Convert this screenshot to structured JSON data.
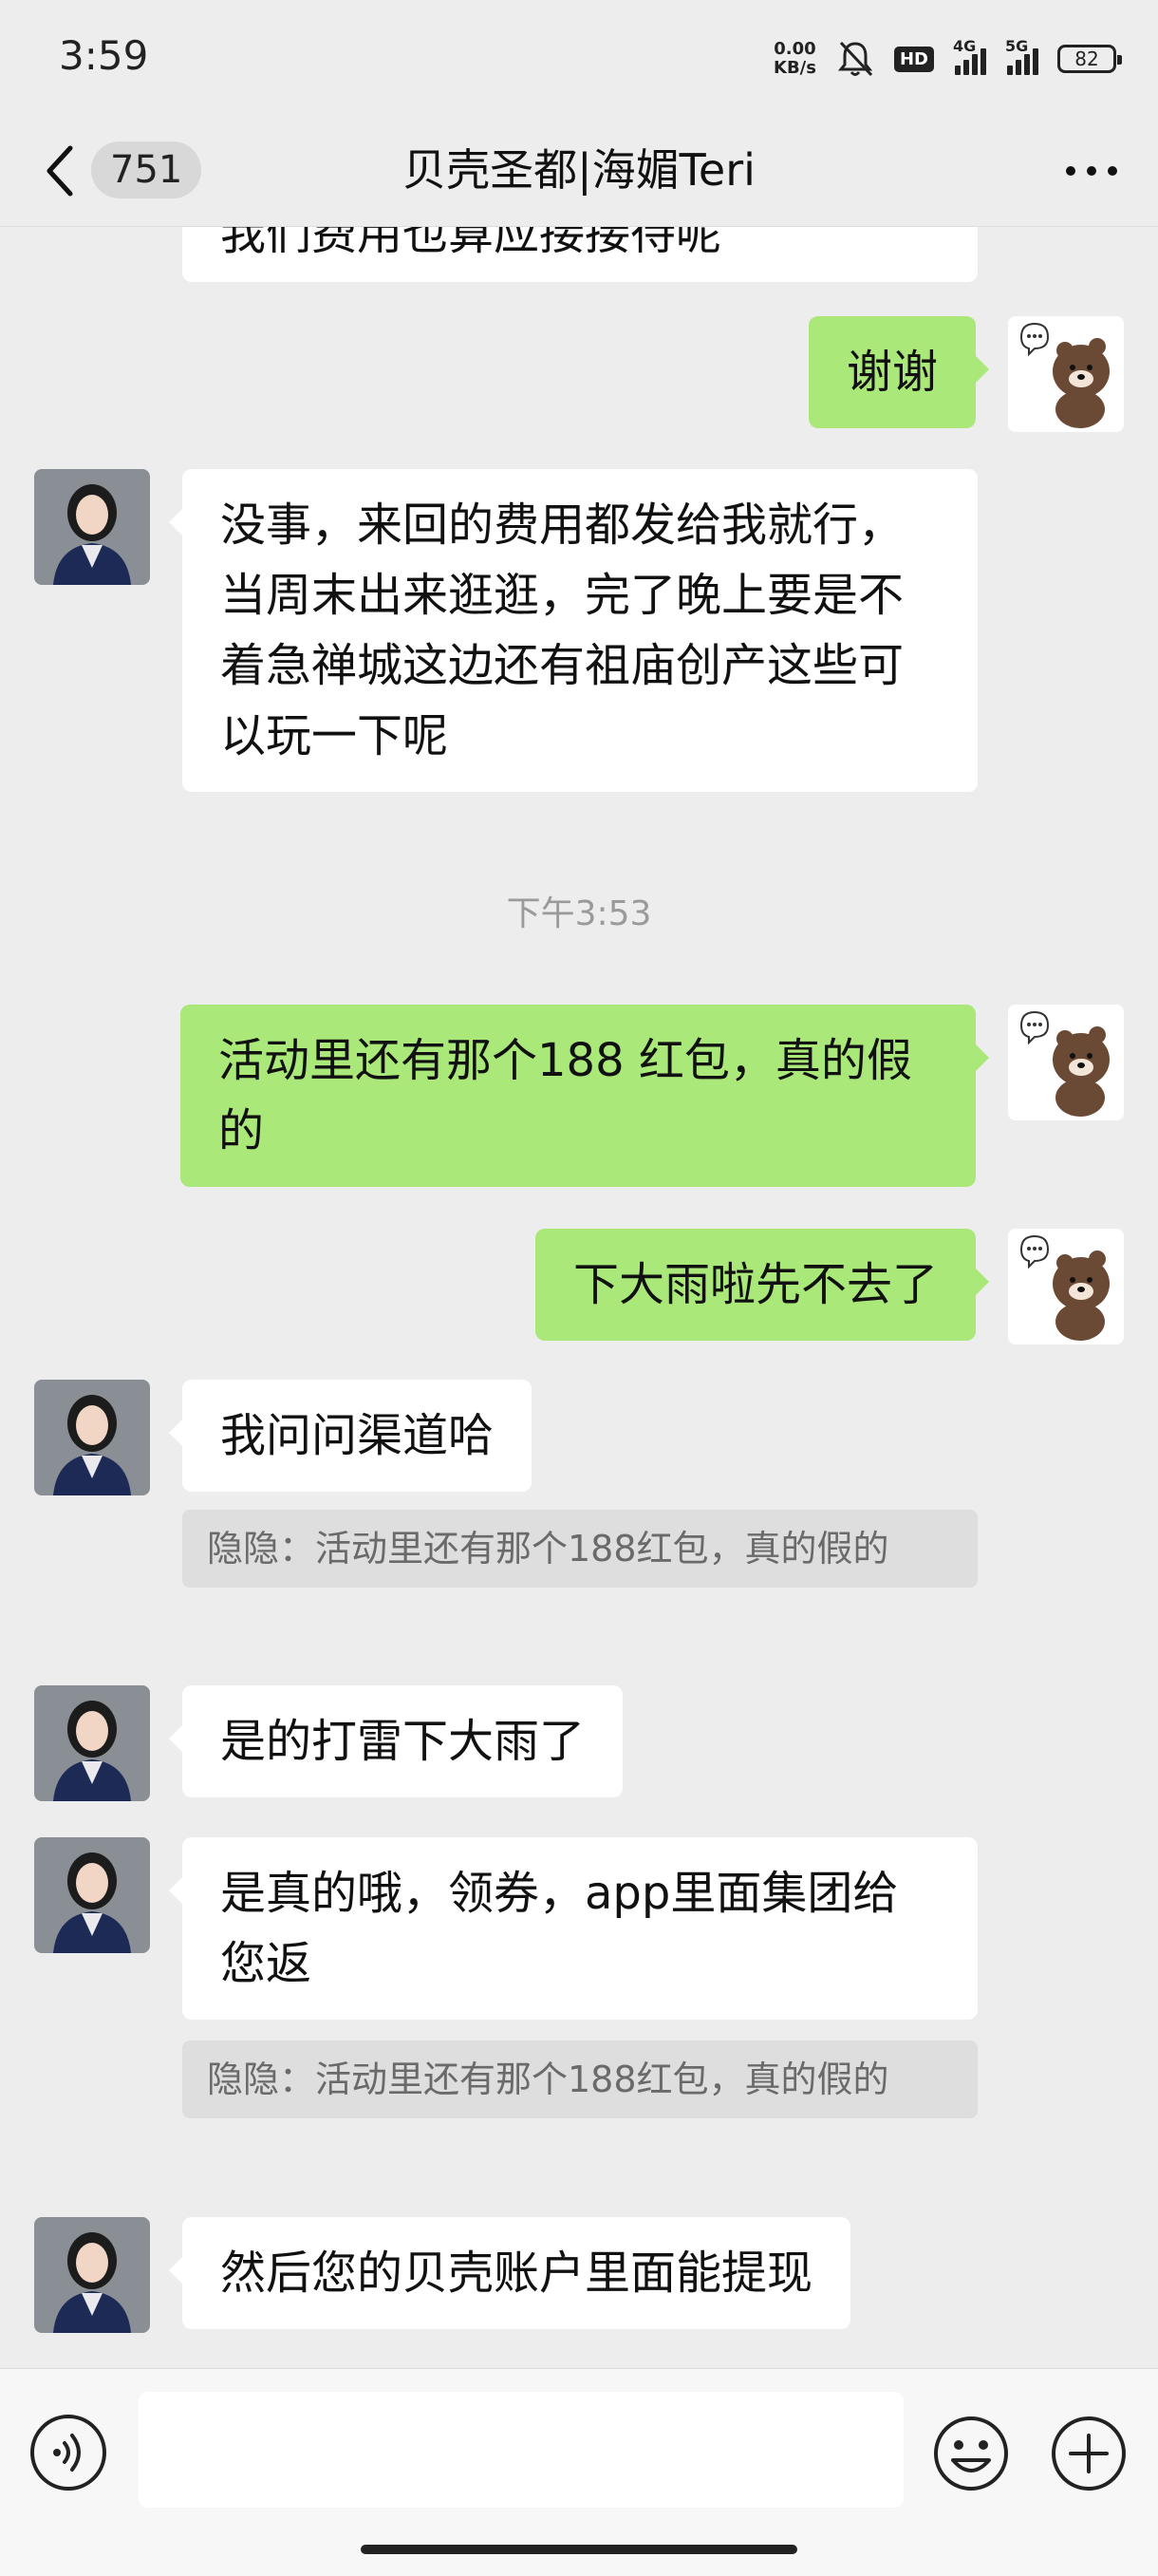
{
  "status_bar": {
    "time": "3:59",
    "net_speed_value": "0.00",
    "net_speed_unit": "KB/s",
    "hd_label": "HD",
    "network_1": "4G",
    "network_2": "5G",
    "battery": "82"
  },
  "header": {
    "unread_count": "751",
    "title": "贝壳圣都|海媚Teri"
  },
  "messages": [
    {
      "side": "in",
      "text": "我们费用也算应接接待呢"
    },
    {
      "side": "out",
      "text": "谢谢"
    },
    {
      "side": "in",
      "text": "没事，来回的费用都发给我就行，当周末出来逛逛，完了晚上要是不着急禅城这边还有祖庙创产这些可以玩一下呢"
    },
    {
      "side": "time",
      "text": "下午3:53"
    },
    {
      "side": "out",
      "text": "活动里还有那个188 红包，真的假的"
    },
    {
      "side": "out",
      "text": "下大雨啦先不去了"
    },
    {
      "side": "in",
      "text": "我问问渠道哈"
    },
    {
      "side": "quote",
      "text": "隐隐：活动里还有那个188红包，真的假的"
    },
    {
      "side": "in",
      "text": "是的打雷下大雨了"
    },
    {
      "side": "in",
      "text": "是真的哦，领券，app里面集团给您返"
    },
    {
      "side": "quote",
      "text": "隐隐：活动里还有那个188红包，真的假的"
    },
    {
      "side": "in",
      "text": "然后您的贝壳账户里面能提现"
    }
  ],
  "input": {
    "value": ""
  },
  "icons": {
    "back": "chevron-left-icon",
    "more": "more-dots-icon",
    "voice": "voice-icon",
    "emoji": "emoji-icon",
    "plus": "plus-icon"
  },
  "colors": {
    "outgoing_bubble": "#a9e879",
    "incoming_bubble": "#ffffff",
    "background": "#ededed",
    "quote_bg": "#dedede"
  }
}
